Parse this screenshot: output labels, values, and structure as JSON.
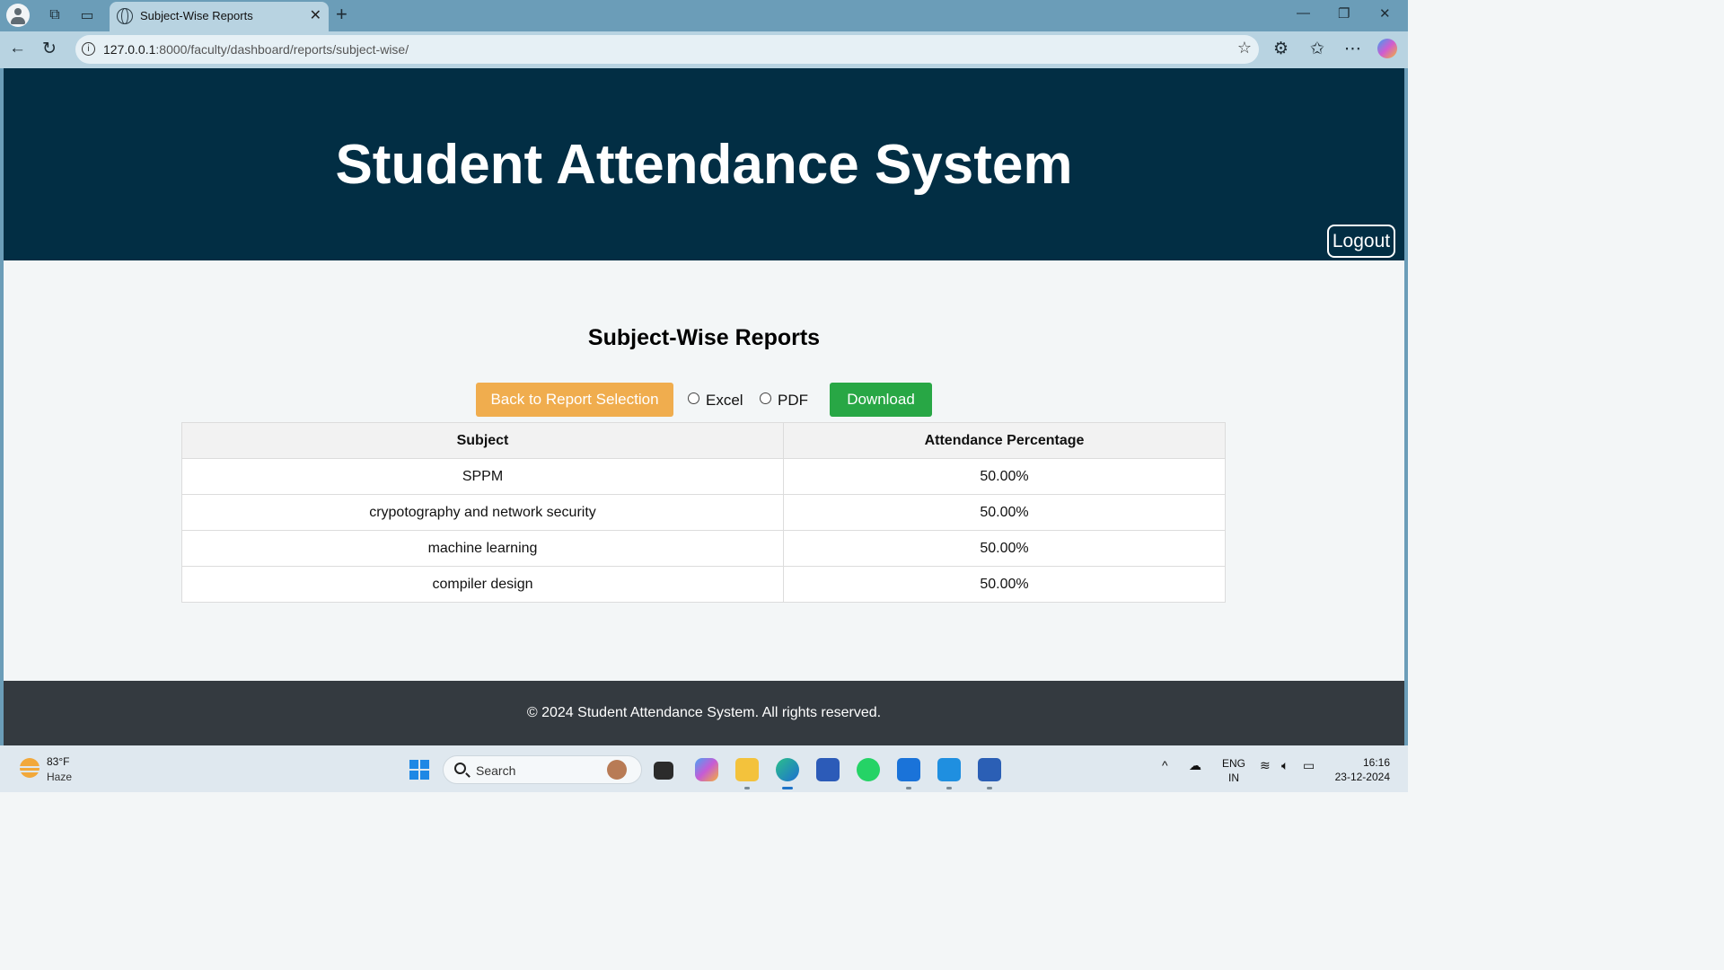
{
  "browser": {
    "tab_title": "Subject-Wise Reports",
    "url_host": "127.0.0.1",
    "url_rest": ":8000/faculty/dashboard/reports/subject-wise/"
  },
  "header": {
    "title": "Student Attendance System",
    "logout_label": "Logout"
  },
  "main": {
    "title": "Subject-Wise Reports",
    "back_button": "Back to Report Selection",
    "format_options": [
      "Excel",
      "PDF"
    ],
    "download_button": "Download"
  },
  "table": {
    "headers": [
      "Subject",
      "Attendance Percentage"
    ],
    "rows": [
      [
        "SPPM",
        "50.00%"
      ],
      [
        "crypotography and network security",
        "50.00%"
      ],
      [
        "machine learning",
        "50.00%"
      ],
      [
        "compiler design",
        "50.00%"
      ]
    ]
  },
  "footer": {
    "text": "© 2024 Student Attendance System. All rights reserved."
  },
  "taskbar": {
    "weather_temp": "83°F",
    "weather_desc": "Haze",
    "search_placeholder": "Search",
    "lang_1": "ENG",
    "lang_2": "IN",
    "time": "16:16",
    "date": "23-12-2024"
  },
  "colors": {
    "header_bg": "#022e44",
    "back_button": "#f0ad4e",
    "download_button": "#28a745",
    "footer_bg": "#343a40"
  }
}
